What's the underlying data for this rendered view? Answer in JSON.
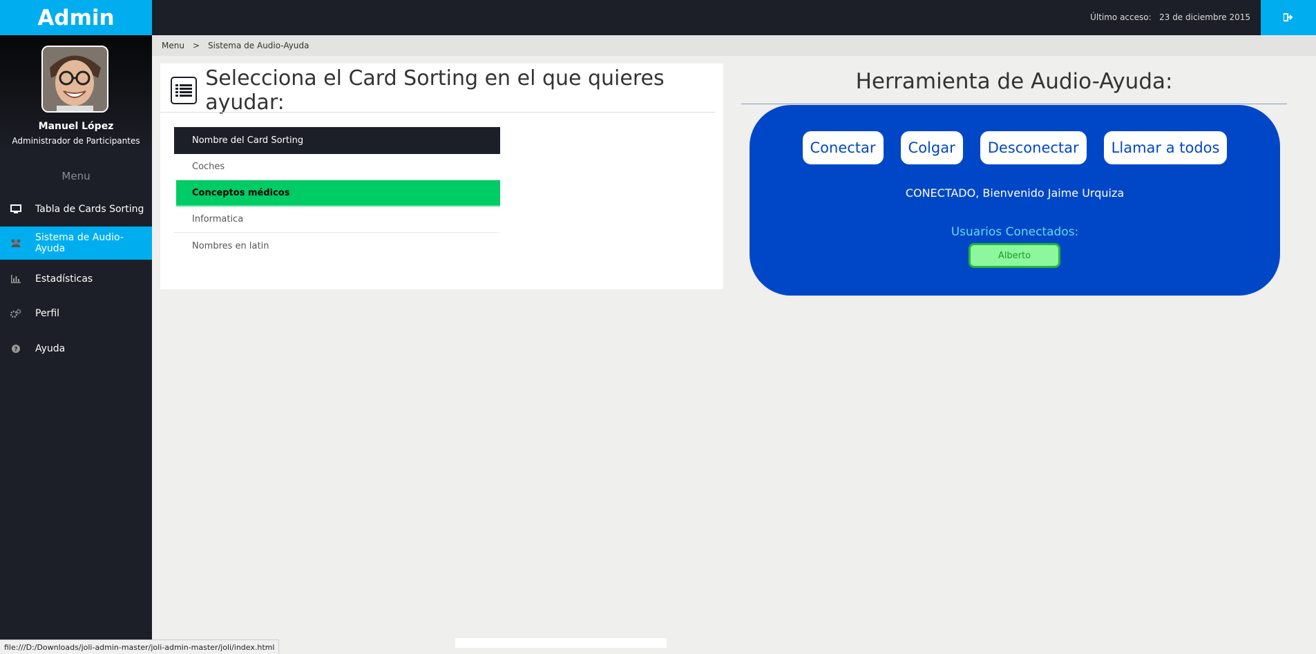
{
  "sidebar": {
    "brand": "Admin",
    "user_name": "Manuel López",
    "user_role": "Administrador de Participantes",
    "menu_title": "Menu",
    "items": [
      {
        "label": "Tabla de Cards Sorting",
        "icon": "monitor-icon",
        "active": false
      },
      {
        "label": "Sistema de Audio-Ayuda",
        "icon": "group-icon",
        "active": true
      },
      {
        "label": "Estadísticas",
        "icon": "bar-chart-icon",
        "active": false
      },
      {
        "label": "Perfil",
        "icon": "gears-icon",
        "active": false
      },
      {
        "label": "Ayuda",
        "icon": "question-icon",
        "active": false
      }
    ]
  },
  "topbar": {
    "last_access_label": "Último acceso:",
    "last_access_date": "23 de diciembre 2015",
    "logout_icon": "sign-out-icon"
  },
  "breadcrumb": {
    "root": "Menu",
    "separator": ">",
    "current": "Sistema de Audio-Ayuda"
  },
  "card_panel": {
    "title": "Selecciona el Card Sorting en el que quieres ayudar:",
    "column_header": "Nombre del Card Sorting",
    "rows": [
      "Coches",
      "Conceptos médicos",
      "Informatica",
      "Nombres en latin"
    ],
    "selected_index": 1
  },
  "audio_tool": {
    "title": "Herramienta de Audio-Ayuda:",
    "buttons": [
      "Conectar",
      "Colgar",
      "Desconectar",
      "Llamar a todos"
    ],
    "status": "CONECTADO, Bienvenido Jaime Urquiza",
    "users_label": "Usuarios Conectados:",
    "users": [
      "Alberto"
    ]
  },
  "status_bar": {
    "url": "file:///D:/Downloads/joli-admin-master/joli-admin-master/joli/index.html"
  },
  "colors": {
    "accent": "#00aef0",
    "dark": "#1c1f27",
    "selected_row": "#00cc66",
    "audio_panel": "#0047c8"
  }
}
